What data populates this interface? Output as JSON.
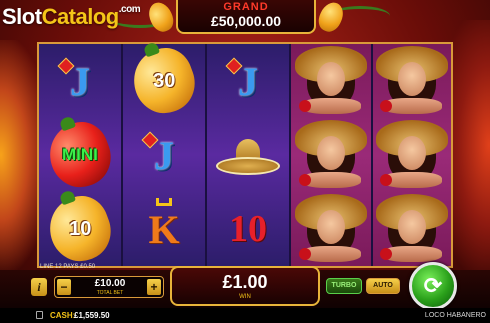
{
  "logo": {
    "slot": "Slot",
    "catalog": "Catalog",
    "com": ".com"
  },
  "jackpot": {
    "title": "GRAND",
    "value": "£50,000.00"
  },
  "reels": [
    {
      "cells": [
        {
          "symbol": "J"
        },
        {
          "symbol": "MINI"
        },
        {
          "symbol": "10"
        }
      ]
    },
    {
      "cells": [
        {
          "symbol": "30"
        },
        {
          "symbol": "J"
        },
        {
          "symbol": "K"
        }
      ]
    },
    {
      "cells": [
        {
          "symbol": "J"
        },
        {
          "symbol": "sombrero-icon"
        },
        {
          "symbol": "10"
        }
      ]
    },
    {
      "cells": [
        {
          "symbol": "lady-icon"
        },
        {
          "symbol": "lady-icon"
        },
        {
          "symbol": "lady-icon"
        }
      ]
    },
    {
      "cells": [
        {
          "symbol": "lady-icon"
        },
        {
          "symbol": "lady-icon"
        },
        {
          "symbol": "lady-icon"
        }
      ]
    }
  ],
  "line_info": "LINE 12 PAYS £0.50",
  "controls": {
    "info": "i",
    "minus": "−",
    "plus": "+",
    "bet_value": "£10.00",
    "bet_label": "TOTAL BET",
    "win_value": "£1.00",
    "win_label": "WIN",
    "turbo": "TURBO",
    "auto": "AUTO",
    "spin_symbol": "⟳"
  },
  "footer": {
    "cash_label": "CASH:",
    "cash_value": "£1,559.50",
    "game_name": "LOCO HABANERO"
  },
  "colors": {
    "gold": "#e8b43a",
    "reel_purple": "#5a2aa0",
    "reel_magenta": "#9a2a78",
    "spin_green": "#2aa01a"
  }
}
